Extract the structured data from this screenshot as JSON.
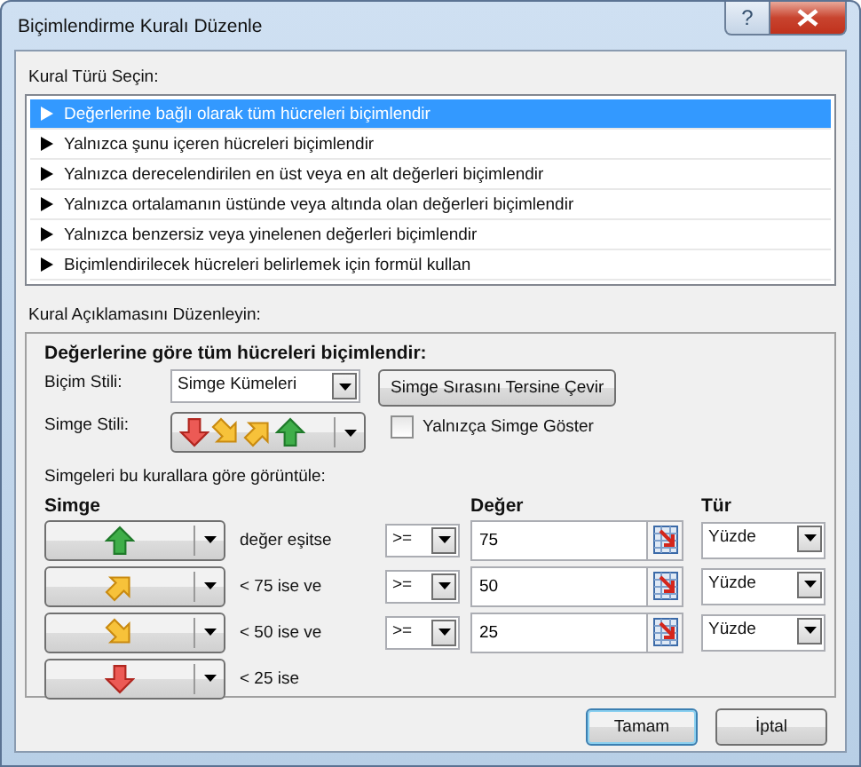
{
  "window": {
    "title": "Biçimlendirme Kuralı Düzenle",
    "help": "?"
  },
  "rule_type": {
    "label": "Kural Türü Seçin:",
    "items": [
      {
        "label": "Değerlerine bağlı olarak tüm hücreleri biçimlendir",
        "selected": true
      },
      {
        "label": "Yalnızca şunu içeren hücreleri biçimlendir",
        "selected": false
      },
      {
        "label": "Yalnızca derecelendirilen en üst veya en alt değerleri biçimlendir",
        "selected": false
      },
      {
        "label": "Yalnızca ortalamanın üstünde veya altında olan değerleri biçimlendir",
        "selected": false
      },
      {
        "label": "Yalnızca benzersiz veya yinelenen değerleri biçimlendir",
        "selected": false
      },
      {
        "label": "Biçimlendirilecek hücreleri belirlemek için formül kullan",
        "selected": false
      }
    ]
  },
  "description": {
    "label": "Kural Açıklamasını Düzenleyin:",
    "heading": "Değerlerine göre tüm hücreleri biçimlendir:",
    "format_style": {
      "label": "Biçim Stili:",
      "value": "Simge Kümeleri"
    },
    "reverse_button": "Simge Sırasını Tersine Çevir",
    "icon_style": {
      "label": "Simge Stili:",
      "icons": [
        {
          "kind": "down"
        },
        {
          "kind": "down-right"
        },
        {
          "kind": "up-right"
        },
        {
          "kind": "up"
        }
      ]
    },
    "icon_only": {
      "label": "Yalnızça Simge Göster",
      "checked": false
    },
    "rules_label": "Simgeleri bu kurallara göre görüntüle:",
    "columns": [
      "Simge",
      "Değer",
      "Tür"
    ],
    "rules": [
      {
        "kind": "up",
        "condition": "değer eşitse",
        "operator": ">=",
        "value": "75",
        "type": "Yüzde"
      },
      {
        "kind": "up-right",
        "condition": "< 75 ise ve",
        "operator": ">=",
        "value": "50",
        "type": "Yüzde"
      },
      {
        "kind": "down-right",
        "condition": "< 50 ise ve",
        "operator": ">=",
        "value": "25",
        "type": "Yüzde"
      },
      {
        "kind": "down",
        "condition": "< 25 ise"
      }
    ]
  },
  "buttons": [
    {
      "label": "Tamam",
      "default": true
    },
    {
      "label": "İptal",
      "default": false
    }
  ]
}
